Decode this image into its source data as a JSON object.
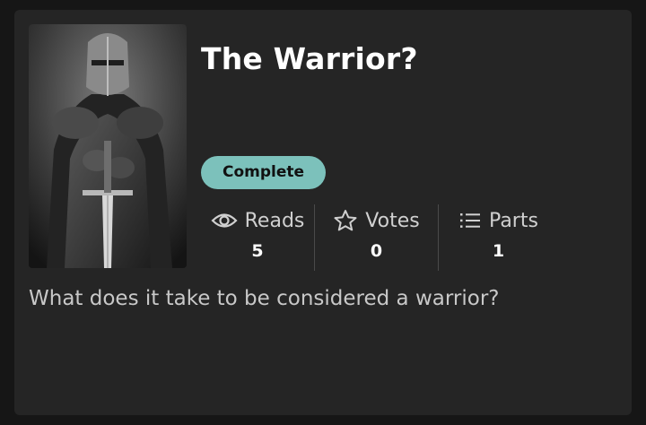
{
  "story": {
    "title": "The Warrior?",
    "status": "Complete",
    "description": "What does it take to be considered a warrior?",
    "stats": {
      "reads": {
        "label": "Reads",
        "value": "5",
        "icon": "eye-icon"
      },
      "votes": {
        "label": "Votes",
        "value": "0",
        "icon": "star-icon"
      },
      "parts": {
        "label": "Parts",
        "value": "1",
        "icon": "list-icon"
      }
    }
  },
  "colors": {
    "background": "#161616",
    "card": "#252525",
    "badge": "#7cc1bb",
    "text": "#ffffff",
    "muted": "#c8c8c8"
  }
}
